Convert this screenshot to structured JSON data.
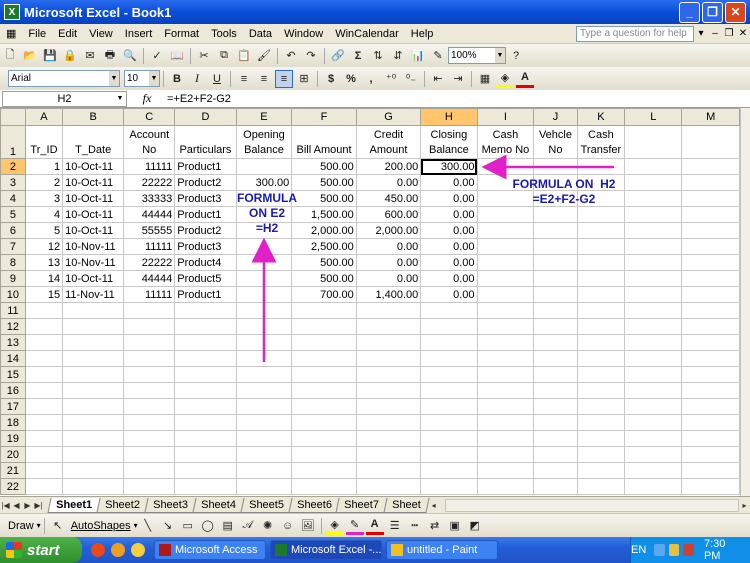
{
  "window": {
    "title": "Microsoft Excel - Book1",
    "app_icon": "excel-icon"
  },
  "menu": {
    "items": [
      "File",
      "Edit",
      "View",
      "Insert",
      "Format",
      "Tools",
      "Data",
      "Window",
      "WinCalendar",
      "Help"
    ],
    "ask_placeholder": "Type a question for help"
  },
  "toolbar": {
    "zoom": "100%"
  },
  "format_toolbar": {
    "font": "Arial",
    "size": "10",
    "bold": "B",
    "italic": "I",
    "underline": "U",
    "currency": "$",
    "percent": "%",
    "comma": ","
  },
  "formula_bar": {
    "name_box": "H2",
    "fx": "fx",
    "formula": "=+E2+F2-G2"
  },
  "columns": [
    "A",
    "B",
    "C",
    "D",
    "E",
    "F",
    "G",
    "H",
    "I",
    "J",
    "K",
    "L",
    "M"
  ],
  "header_row": {
    "row_number": "1",
    "cells": [
      "Tr_ID",
      "T_Date",
      "Account No",
      "Particulars",
      "Opening Balance",
      "Bill Amount",
      "Credit Amount",
      "Closing Balance",
      "Cash Memo No",
      "Vehcle No",
      "Cash Transfer",
      "",
      ""
    ]
  },
  "rows": [
    {
      "n": "2",
      "cells": [
        "1",
        "10-Oct-11",
        "11111",
        "Product1",
        "",
        "500.00",
        "200.00",
        "300.00",
        "",
        "",
        "",
        "",
        ""
      ]
    },
    {
      "n": "3",
      "cells": [
        "2",
        "10-Oct-11",
        "22222",
        "Product2",
        "300.00",
        "500.00",
        "0.00",
        "0.00",
        "",
        "",
        "",
        "",
        ""
      ]
    },
    {
      "n": "4",
      "cells": [
        "3",
        "10-Oct-11",
        "33333",
        "Product3",
        "",
        "500.00",
        "450.00",
        "0.00",
        "",
        "",
        "",
        "",
        ""
      ]
    },
    {
      "n": "5",
      "cells": [
        "4",
        "10-Oct-11",
        "44444",
        "Product1",
        "",
        "1,500.00",
        "600.00",
        "0.00",
        "",
        "",
        "",
        "",
        ""
      ]
    },
    {
      "n": "6",
      "cells": [
        "5",
        "10-Oct-11",
        "55555",
        "Product2",
        "",
        "2,000.00",
        "2,000.00",
        "0.00",
        "",
        "",
        "",
        "",
        ""
      ]
    },
    {
      "n": "7",
      "cells": [
        "12",
        "10-Nov-11",
        "11111",
        "Product3",
        "",
        "2,500.00",
        "0.00",
        "0.00",
        "",
        "",
        "",
        "",
        ""
      ]
    },
    {
      "n": "8",
      "cells": [
        "13",
        "10-Nov-11",
        "22222",
        "Product4",
        "",
        "500.00",
        "0.00",
        "0.00",
        "",
        "",
        "",
        "",
        ""
      ]
    },
    {
      "n": "9",
      "cells": [
        "14",
        "10-Oct-11",
        "44444",
        "Product5",
        "",
        "500.00",
        "0.00",
        "0.00",
        "",
        "",
        "",
        "",
        ""
      ]
    },
    {
      "n": "10",
      "cells": [
        "15",
        "11-Nov-11",
        "11111",
        "Product1",
        "",
        "700.00",
        "1,400.00",
        "0.00",
        "",
        "",
        "",
        "",
        ""
      ]
    },
    {
      "n": "11",
      "cells": [
        "",
        "",
        "",
        "",
        "",
        "",
        "",
        "",
        "",
        "",
        "",
        "",
        ""
      ]
    },
    {
      "n": "12",
      "cells": [
        "",
        "",
        "",
        "",
        "",
        "",
        "",
        "",
        "",
        "",
        "",
        "",
        ""
      ]
    },
    {
      "n": "13",
      "cells": [
        "",
        "",
        "",
        "",
        "",
        "",
        "",
        "",
        "",
        "",
        "",
        "",
        ""
      ]
    },
    {
      "n": "14",
      "cells": [
        "",
        "",
        "",
        "",
        "",
        "",
        "",
        "",
        "",
        "",
        "",
        "",
        ""
      ]
    },
    {
      "n": "15",
      "cells": [
        "",
        "",
        "",
        "",
        "",
        "",
        "",
        "",
        "",
        "",
        "",
        "",
        ""
      ]
    },
    {
      "n": "16",
      "cells": [
        "",
        "",
        "",
        "",
        "",
        "",
        "",
        "",
        "",
        "",
        "",
        "",
        ""
      ]
    },
    {
      "n": "17",
      "cells": [
        "",
        "",
        "",
        "",
        "",
        "",
        "",
        "",
        "",
        "",
        "",
        "",
        ""
      ]
    },
    {
      "n": "18",
      "cells": [
        "",
        "",
        "",
        "",
        "",
        "",
        "",
        "",
        "",
        "",
        "",
        "",
        ""
      ]
    },
    {
      "n": "19",
      "cells": [
        "",
        "",
        "",
        "",
        "",
        "",
        "",
        "",
        "",
        "",
        "",
        "",
        ""
      ]
    },
    {
      "n": "20",
      "cells": [
        "",
        "",
        "",
        "",
        "",
        "",
        "",
        "",
        "",
        "",
        "",
        "",
        ""
      ]
    },
    {
      "n": "21",
      "cells": [
        "",
        "",
        "",
        "",
        "",
        "",
        "",
        "",
        "",
        "",
        "",
        "",
        ""
      ]
    },
    {
      "n": "22",
      "cells": [
        "",
        "",
        "",
        "",
        "",
        "",
        "",
        "",
        "",
        "",
        "",
        "",
        ""
      ]
    }
  ],
  "annotations": {
    "h2": "FORMULA ON  H2\n=E2+F2-G2",
    "e2": "FORMULA\nON E2\n=H2"
  },
  "sheets": [
    "Sheet1",
    "Sheet2",
    "Sheet3",
    "Sheet4",
    "Sheet5",
    "Sheet6",
    "Sheet7",
    "Sheet"
  ],
  "draw_toolbar": {
    "draw": "Draw",
    "autoshapes": "AutoShapes"
  },
  "taskbar": {
    "start": "start",
    "tasks": [
      "Microsoft Access",
      "Microsoft Excel -...",
      "untitled - Paint"
    ],
    "lang": "EN",
    "clock": "7:30 PM"
  },
  "colors": {
    "arrow": "#e020c8",
    "annotation": "#1a1ab0",
    "selected_header": "#ffc66e"
  }
}
